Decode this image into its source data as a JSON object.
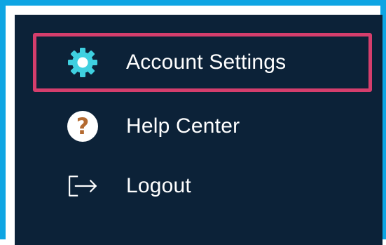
{
  "menu": {
    "items": [
      {
        "label": "Account Settings",
        "icon": "gear-icon",
        "selected": true
      },
      {
        "label": "Help Center",
        "icon": "help-circle-icon",
        "selected": false
      },
      {
        "label": "Logout",
        "icon": "logout-icon",
        "selected": false
      }
    ]
  },
  "colors": {
    "panel_background": "#0c2238",
    "frame_border": "#0ea5e3",
    "selection_border": "#d53e6c",
    "gear": "#3fd0e0",
    "help_circle": "#ffffff",
    "help_question": "#b46a30",
    "text": "#ffffff"
  }
}
